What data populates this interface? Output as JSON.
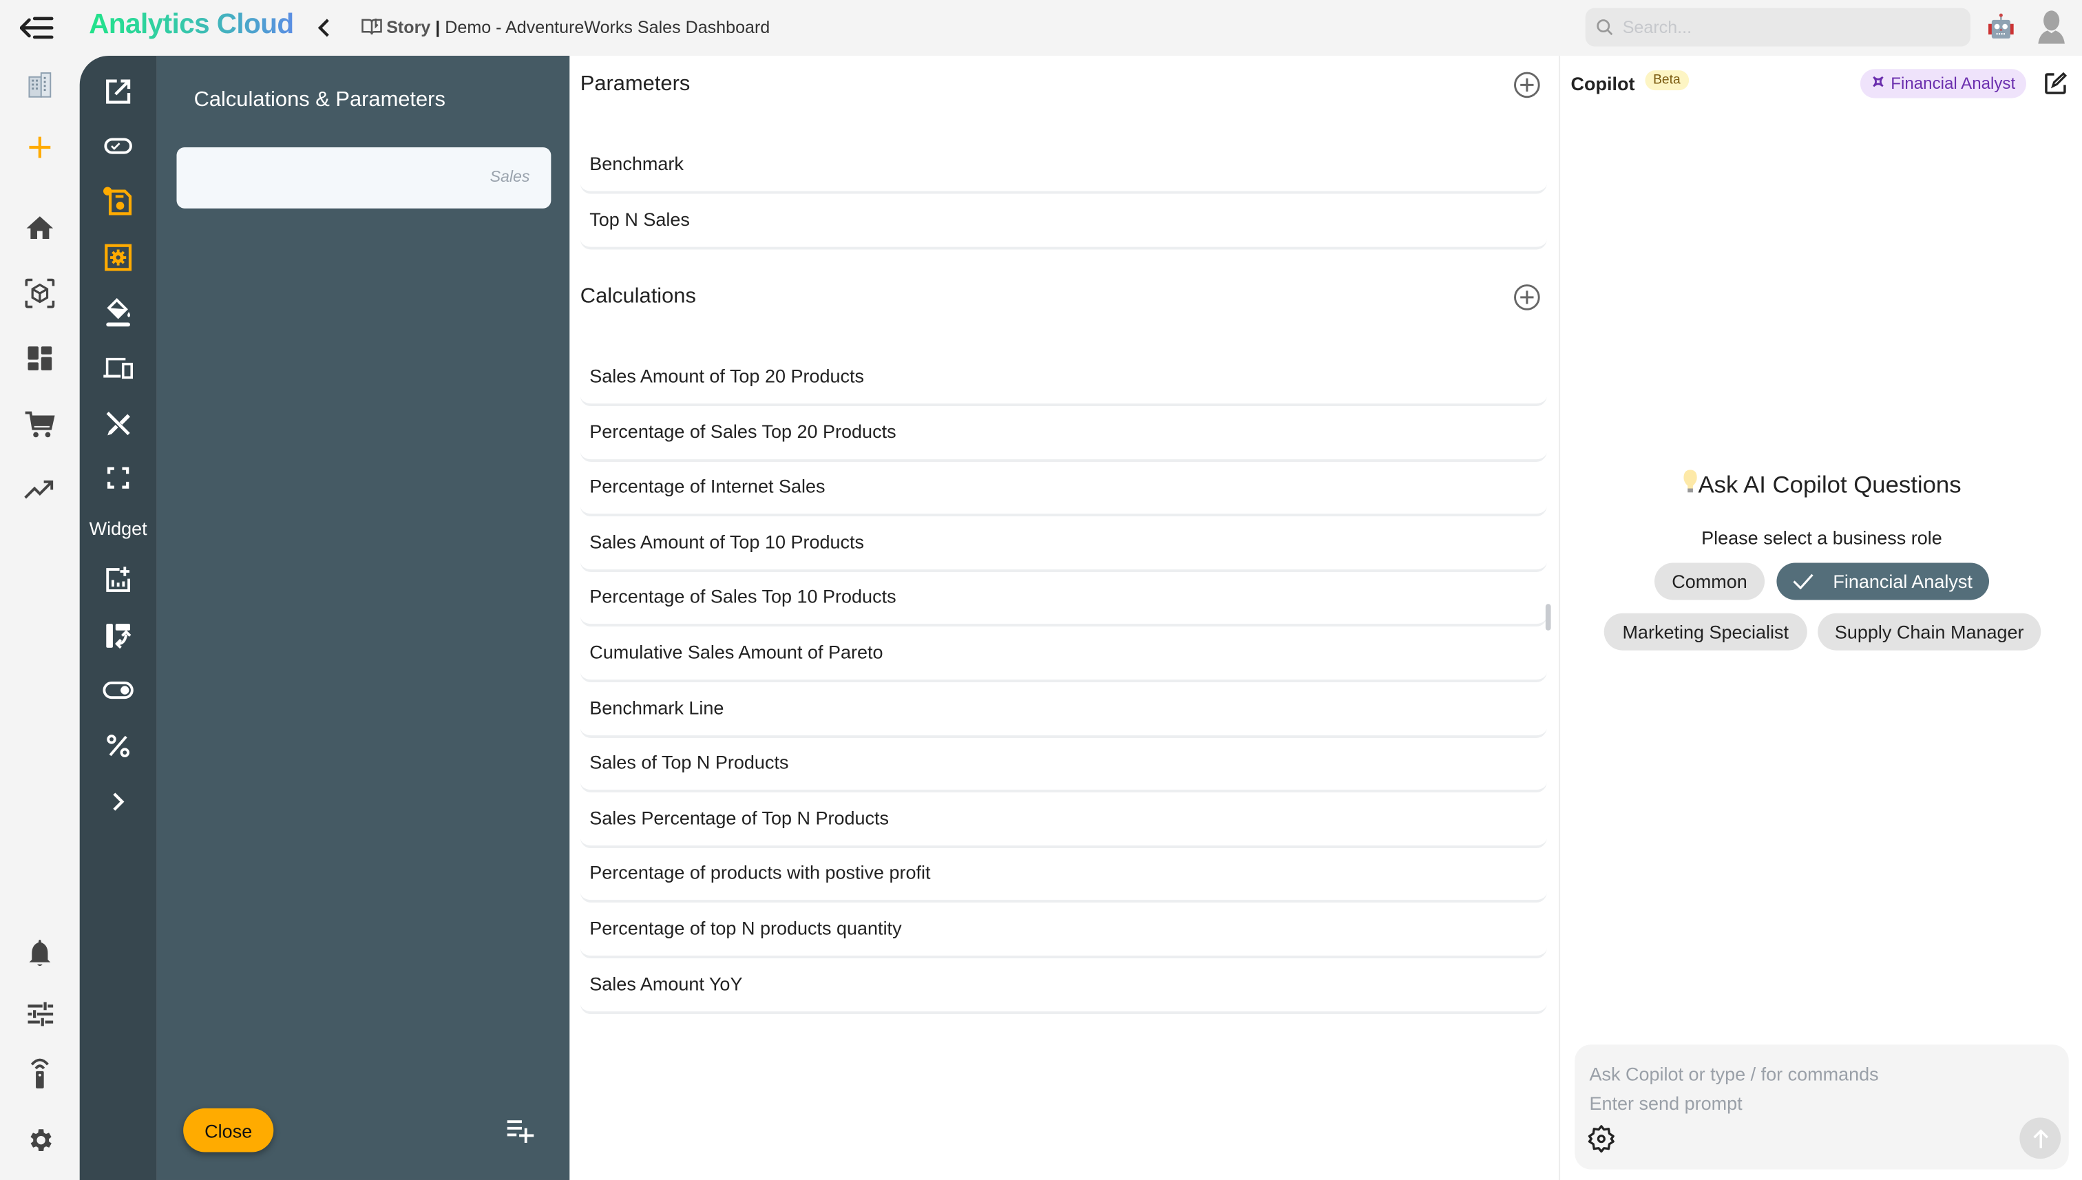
{
  "header": {
    "app_title": "Analytics Cloud",
    "breadcrumb_type": "Story",
    "breadcrumb_separator": "|",
    "breadcrumb_title": "Demo - AdventureWorks Sales Dashboard",
    "search_placeholder": "Search..."
  },
  "rail": {
    "items": [
      "organization",
      "create",
      "home",
      "data-models",
      "dashboards",
      "marketplace",
      "trends"
    ],
    "bottom_items": [
      "notifications",
      "preferences",
      "remote-access",
      "settings"
    ]
  },
  "toolbar": {
    "widget_label": "Widget"
  },
  "calc_panel": {
    "title": "Calculations & Parameters",
    "search_tag": "Sales",
    "close_label": "Close"
  },
  "main": {
    "parameters_title": "Parameters",
    "parameters": [
      "Benchmark",
      "Top N Sales"
    ],
    "calculations_title": "Calculations",
    "calculations": [
      "Sales Amount of Top 20 Products",
      "Percentage of Sales Top 20 Products",
      "Percentage of Internet Sales",
      "Sales Amount of Top 10 Products",
      "Percentage of Sales Top 10 Products",
      "Cumulative Sales Amount of Pareto",
      "Benchmark Line",
      "Sales of Top N Products",
      "Sales Percentage of Top N Products",
      "Percentage of products with postive profit",
      "Percentage of top N products quantity",
      "Sales Amount YoY"
    ]
  },
  "copilot": {
    "title": "Copilot",
    "badge": "Beta",
    "current_role": "Financial Analyst",
    "ask_title": "Ask AI Copilot Questions",
    "ask_subtitle": "Please select a business role",
    "roles": [
      {
        "label": "Common",
        "selected": false
      },
      {
        "label": "Financial Analyst",
        "selected": true
      },
      {
        "label": "Marketing Specialist",
        "selected": false
      },
      {
        "label": "Supply Chain Manager",
        "selected": false
      }
    ],
    "prompt_placeholder_line1": "Ask Copilot or type / for commands",
    "prompt_placeholder_line2": "Enter send prompt"
  },
  "colors": {
    "accent": "#ffab00",
    "toolbar_bg": "#37474f",
    "panel_bg": "#455a64",
    "selected_chip": "#546e7a",
    "role_chip_bg": "#efe3fb",
    "role_chip_text": "#6b2fae"
  }
}
